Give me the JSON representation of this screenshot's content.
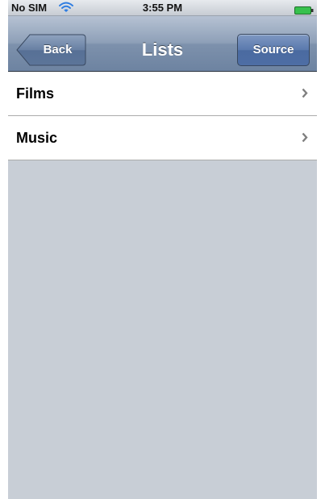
{
  "status_bar": {
    "carrier": "No SIM",
    "time": "3:55 PM",
    "wifi_icon": "wifi-icon",
    "battery_icon": "battery-icon",
    "battery_color": "#37c14d",
    "wifi_color": "#2f7de1"
  },
  "nav_bar": {
    "back_label": "Back",
    "title": "Lists",
    "source_label": "Source"
  },
  "list": {
    "items": [
      {
        "label": "Films",
        "accessory": "chevron-right-icon"
      },
      {
        "label": "Music",
        "accessory": "chevron-right-icon"
      }
    ]
  }
}
